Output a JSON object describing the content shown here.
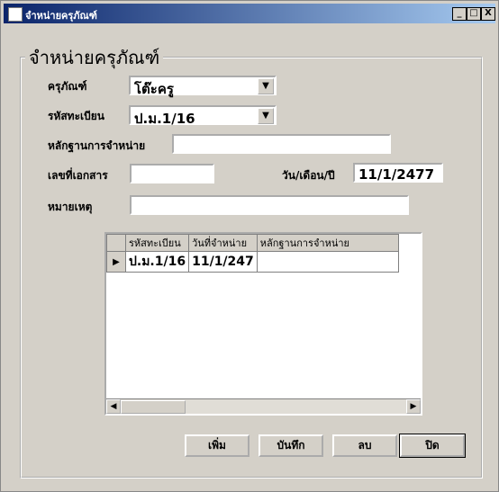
{
  "window": {
    "title": "จำหน่ายครุภัณฑ์",
    "controls": {
      "minimize": "_",
      "maximize": "□",
      "close": "X"
    }
  },
  "form": {
    "group_title": "จำหน่ายครุภัณฑ์",
    "equipment": {
      "label": "ครุภัณฑ์",
      "value": "โต๊ะครู"
    },
    "reg_code": {
      "label": "รหัสทะเบียน",
      "value": "ป.ม.1/16"
    },
    "evidence": {
      "label": "หลักฐานการจำหน่าย",
      "value": ""
    },
    "doc_no": {
      "label": "เลขที่เอกสาร",
      "value": ""
    },
    "date": {
      "label": "วัน/เดือน/ปี",
      "value": "11/1/2477"
    },
    "note": {
      "label": "หมายเหตุ",
      "value": ""
    }
  },
  "grid": {
    "columns": [
      "รหัสทะเบียน",
      "วันที่จำหน่าย",
      "หลักฐานการจำหน่าย"
    ],
    "rows": [
      {
        "marker": "▶",
        "reg_code": "ป.ม.1/16",
        "date": "11/1/247",
        "evidence": ""
      }
    ]
  },
  "buttons": {
    "add": "เพิ่ม",
    "save": "บันทึก",
    "delete": "ลบ",
    "close": "ปิด"
  }
}
